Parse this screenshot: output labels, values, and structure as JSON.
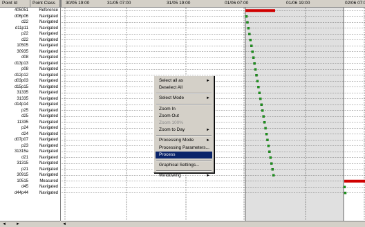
{
  "table": {
    "columns": [
      "Point Id",
      "Point Class"
    ],
    "rows": [
      [
        "405051",
        "Reference"
      ],
      [
        "d06p06",
        "Navigated"
      ],
      [
        "d22",
        "Navigated"
      ],
      [
        "d11p11",
        "Navigated"
      ],
      [
        "p22",
        "Navigated"
      ],
      [
        "d22",
        "Navigated"
      ],
      [
        "10505",
        "Navigated"
      ],
      [
        "30935",
        "Navigated"
      ],
      [
        "d08",
        "Navigated"
      ],
      [
        "d13p13",
        "Navigated"
      ],
      [
        "p08",
        "Navigated"
      ],
      [
        "d12p12",
        "Navigated"
      ],
      [
        "d03p03",
        "Navigated"
      ],
      [
        "d15p15",
        "Navigated"
      ],
      [
        "31335",
        "Navigated"
      ],
      [
        "31335",
        "Navigated"
      ],
      [
        "d14p14",
        "Navigated"
      ],
      [
        "p25",
        "Navigated"
      ],
      [
        "d25",
        "Navigated"
      ],
      [
        "11335",
        "Navigated"
      ],
      [
        "p24",
        "Navigated"
      ],
      [
        "d24",
        "Navigated"
      ],
      [
        "d07p07",
        "Navigated"
      ],
      [
        "p23",
        "Navigated"
      ],
      [
        "31315a",
        "Navigated"
      ],
      [
        "d21",
        "Navigated"
      ],
      [
        "31315",
        "Navigated"
      ],
      [
        "p21",
        "Navigated"
      ],
      [
        "30915",
        "Navigated"
      ],
      [
        "10515",
        "Measured"
      ],
      [
        "d45",
        "Navigated"
      ],
      [
        "d44p44",
        "Navigated"
      ]
    ]
  },
  "timeline": {
    "ticks": [
      "30/05 19:00",
      "31/05 07:00",
      "31/05 19:00",
      "01/06 07:00",
      "01/06 19:00",
      "02/06 07:00"
    ],
    "marker_color": "#1a9a1a",
    "bar_color": "#d00000",
    "shaded_color": "#e0e0e0"
  },
  "context_menu": {
    "items": [
      {
        "label": "Select all as",
        "submenu": true,
        "disabled": false,
        "selected": false
      },
      {
        "label": "Deselect All",
        "submenu": false,
        "disabled": false,
        "selected": false
      },
      {
        "separator": true
      },
      {
        "label": "Select Mode",
        "submenu": true,
        "disabled": false,
        "selected": false
      },
      {
        "separator": true
      },
      {
        "label": "Zoom In",
        "submenu": false,
        "disabled": false,
        "selected": false
      },
      {
        "label": "Zoom Out",
        "submenu": false,
        "disabled": false,
        "selected": false
      },
      {
        "label": "Zoom 100%",
        "submenu": false,
        "disabled": true,
        "selected": false
      },
      {
        "label": "Zoom to Day",
        "submenu": true,
        "disabled": false,
        "selected": false
      },
      {
        "separator": true
      },
      {
        "label": "Processing Mode",
        "submenu": true,
        "disabled": false,
        "selected": false
      },
      {
        "label": "Processing Parameters...",
        "submenu": false,
        "disabled": false,
        "selected": false
      },
      {
        "label": "Process",
        "submenu": false,
        "disabled": false,
        "selected": true
      },
      {
        "separator": true
      },
      {
        "label": "Graphical Settings...",
        "submenu": false,
        "disabled": false,
        "selected": false
      },
      {
        "separator": true
      },
      {
        "label": "Windowing",
        "submenu": true,
        "disabled": false,
        "selected": false
      }
    ]
  }
}
